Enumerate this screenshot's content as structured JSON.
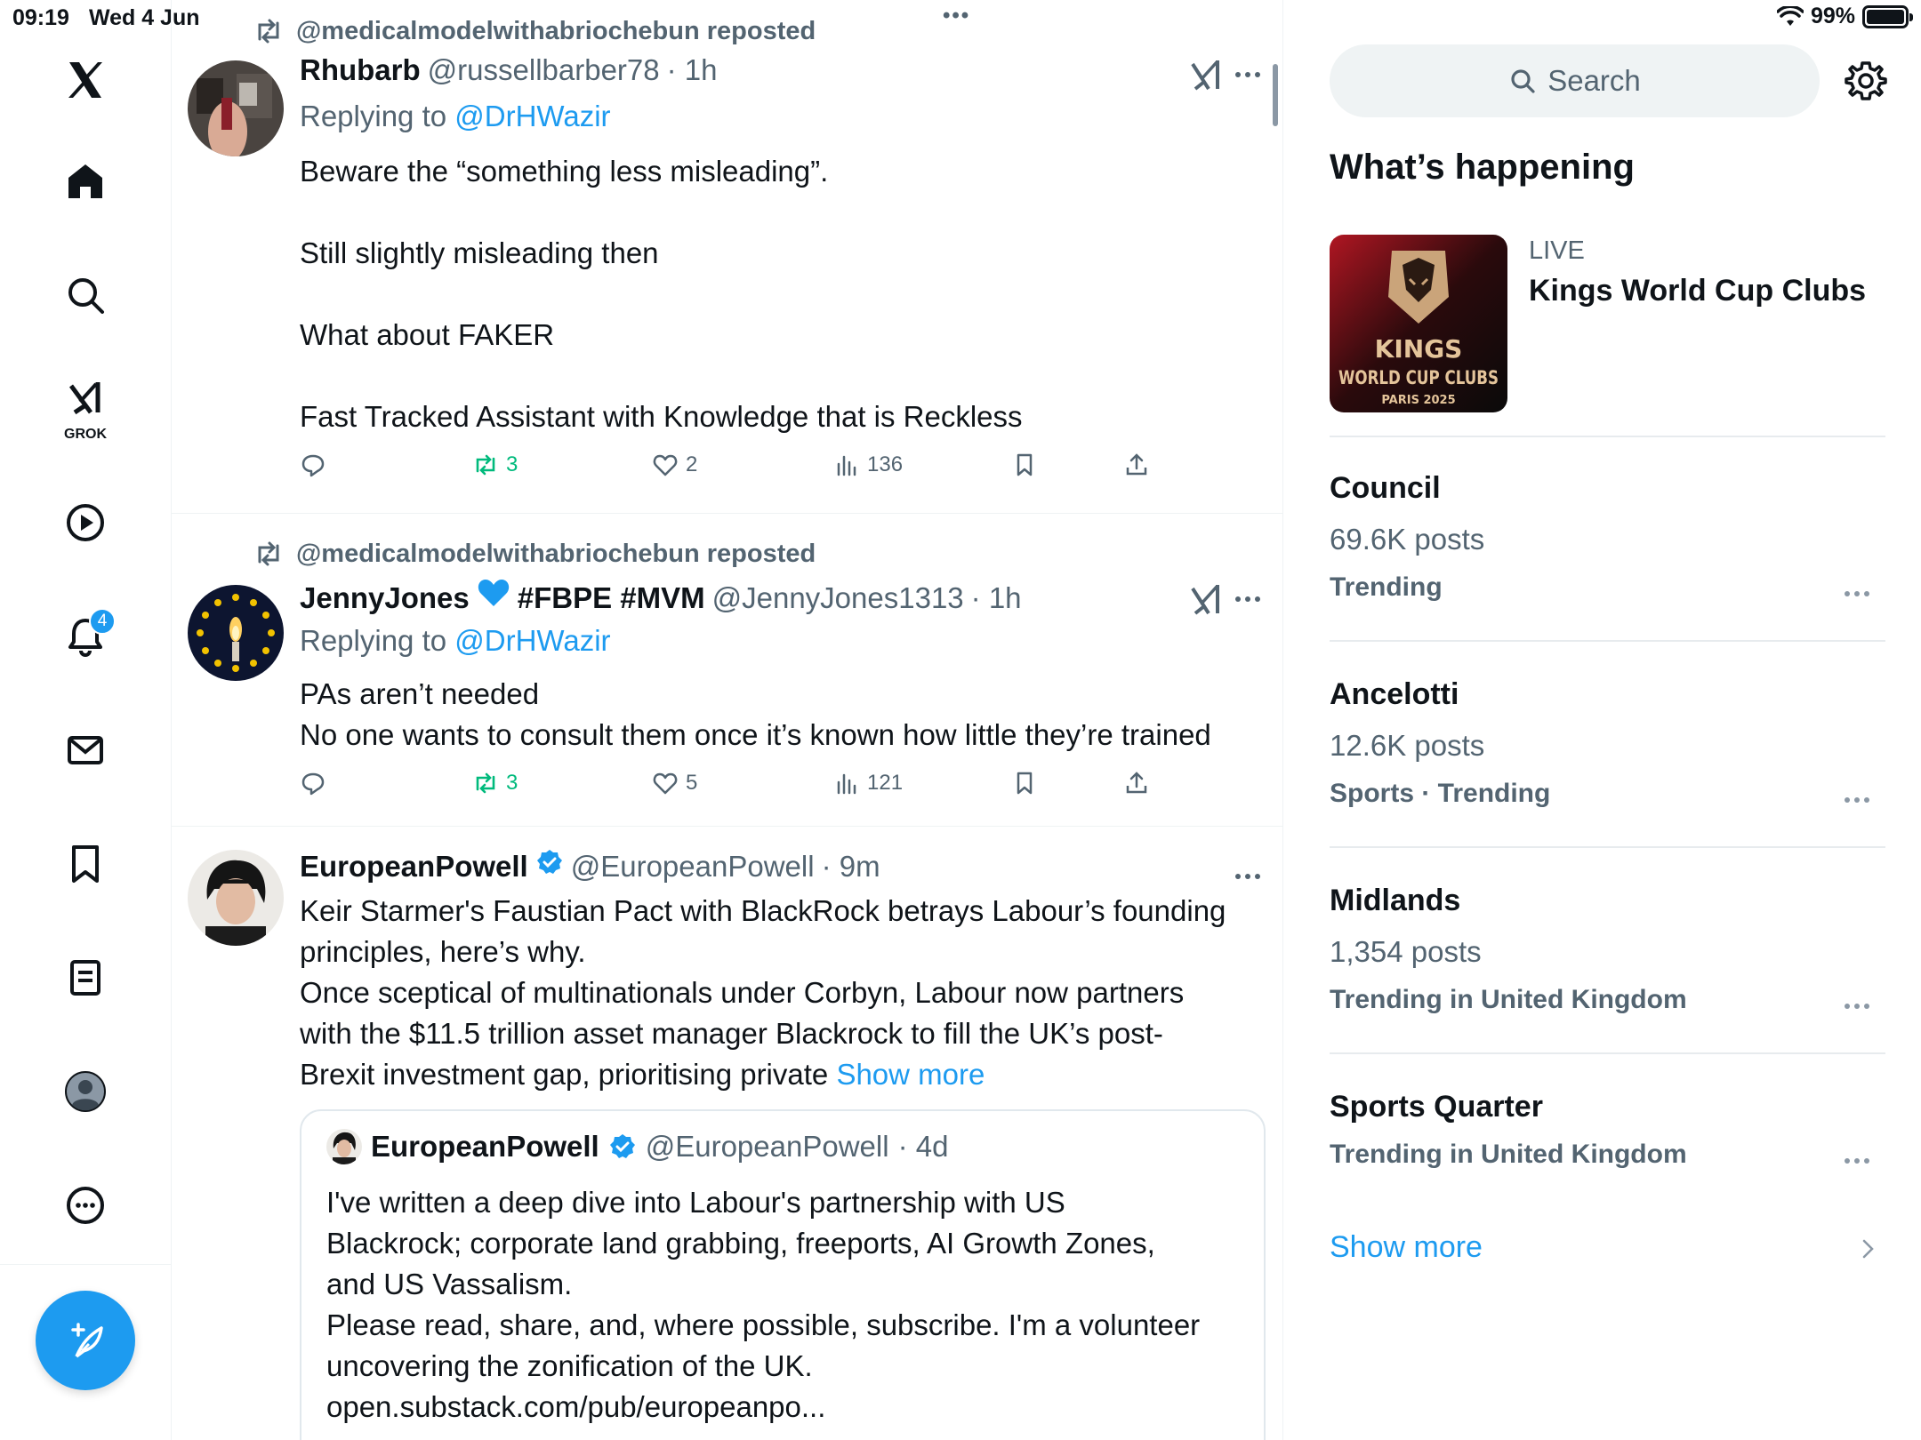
{
  "status_bar": {
    "time": "09:19",
    "date": "Wed 4 Jun",
    "battery": "99%"
  },
  "nav": {
    "notifications_badge": "4",
    "grok_label": "GROK"
  },
  "posts": [
    {
      "repost_by": "@medicalmodelwithabriochebun reposted",
      "author": "Rhubarb",
      "handle": "@russellbarber78",
      "time": "· 1h",
      "replying_prefix": "Replying to",
      "replying_to": "@DrHWazir",
      "lines": [
        "Beware the “something less misleading”.",
        "Still slightly misleading then",
        "What about FAKER",
        "Fast Tracked Assistant with Knowledge that is Reckless"
      ],
      "retweets": "3",
      "likes": "2",
      "views": "136"
    },
    {
      "repost_by": "@medicalmodelwithabriochebun reposted",
      "author": "JennyJones",
      "author_tags": "#FBPE #MVM",
      "handle": "@JennyJones1313",
      "time": "· 1h",
      "replying_prefix": "Replying to",
      "replying_to": "@DrHWazir",
      "lines": [
        "PAs aren’t needed",
        "No one wants to consult them once it’s known how little they’re trained"
      ],
      "retweets": "3",
      "likes": "5",
      "views": "121"
    },
    {
      "author": "EuropeanPowell",
      "handle": "@EuropeanPowell",
      "time": "· 9m",
      "lines": [
        "Keir Starmer's Faustian Pact with BlackRock betrays Labour’s founding",
        "principles, here’s why.",
        "Once sceptical of multinationals under Corbyn, Labour now partners",
        "with the $11.5 trillion asset manager Blackrock to fill the UK’s post-"
      ],
      "last_line": "Brexit investment gap, prioritising private",
      "show_more": "Show more",
      "quote": {
        "author": "EuropeanPowell",
        "handle": "@EuropeanPowell",
        "time": "· 4d",
        "lines": [
          "I've written a deep dive into Labour's partnership with US",
          "Blackrock; corporate land grabbing, freeports, AI Growth Zones,",
          "and US Vassalism.",
          "Please read, share, and, where possible, subscribe. I'm a volunteer",
          "uncovering the zonification of the UK.",
          "open.substack.com/pub/europeanpo..."
        ]
      }
    }
  ],
  "sidebar": {
    "search_placeholder": "Search",
    "title": "What’s happening",
    "live": {
      "label": "LIVE",
      "title": "Kings World Cup Clubs",
      "image_text": [
        "KINGS",
        "WORLD CUP CLUBS",
        "PARIS 2025"
      ]
    },
    "trends": [
      {
        "name": "Council",
        "count": "69.6K posts",
        "context": "Trending"
      },
      {
        "name": "Ancelotti",
        "count": "12.6K posts",
        "context": "Sports · Trending"
      },
      {
        "name": "Midlands",
        "count": "1,354 posts",
        "context": "Trending in United Kingdom"
      },
      {
        "name": "Sports Quarter",
        "count": "",
        "context": "Trending in United Kingdom"
      }
    ],
    "show_more": "Show more"
  },
  "colors": {
    "accent": "#1d9bf0",
    "retweet": "#00ba7c",
    "secondary": "#536471"
  }
}
